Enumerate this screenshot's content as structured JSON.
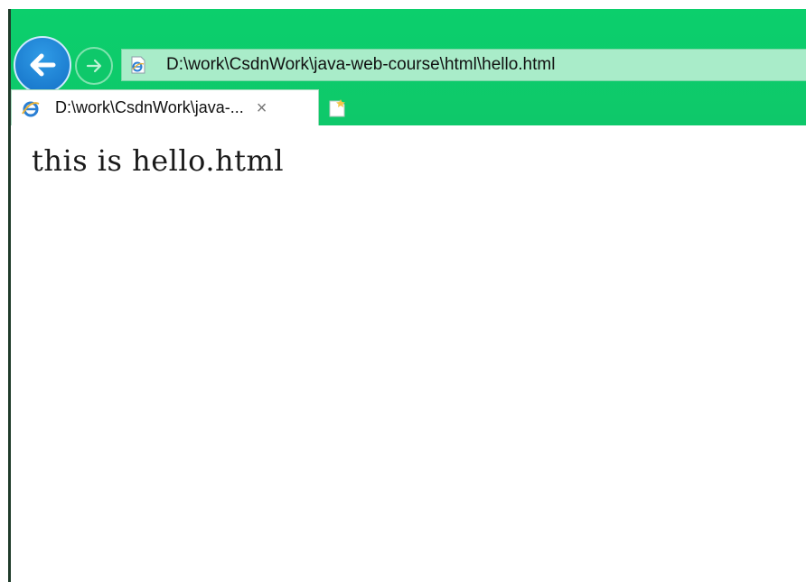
{
  "address_bar": {
    "url": "D:\\work\\CsdnWork\\java-web-course\\html\\hello.html"
  },
  "tab": {
    "title": "D:\\work\\CsdnWork\\java-...",
    "close_glyph": "×"
  },
  "content": {
    "text": "this is hello.html"
  },
  "colors": {
    "chrome": "#0ccf6c",
    "address_bar_bg": "#a9ecc9",
    "back_button": "#1470c6"
  },
  "icons": {
    "back": "back-arrow-icon",
    "forward": "forward-arrow-icon",
    "page": "ie-page-icon",
    "tab": "ie-logo-icon",
    "new_tab": "new-tab-icon"
  }
}
